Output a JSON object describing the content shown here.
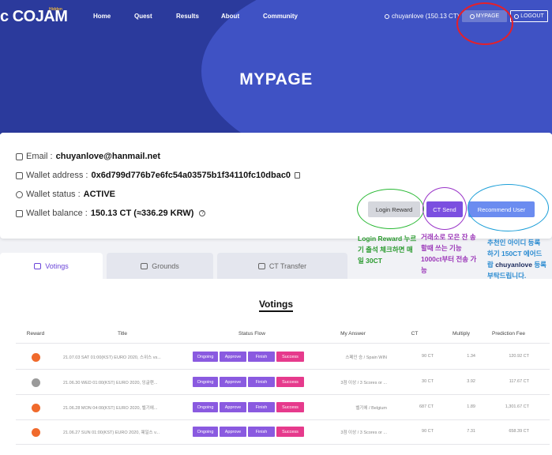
{
  "header": {
    "logo": "COJAM",
    "logo_sub": "Hidden",
    "nav": [
      "Home",
      "Quest",
      "Results",
      "About",
      "Community"
    ],
    "user": "chuyanlove (150.13 CT)",
    "mypage_label": "MYPAGE",
    "logout_label": "LOGOUT"
  },
  "hero": {
    "title": "MYPAGE"
  },
  "account": {
    "email_label": "Email : ",
    "email": "chuyanlove@hanmail.net",
    "wallet_address_label": "Wallet address : ",
    "wallet_address": "0x6d799d776b7e6fc54a03575b1f34110fc10dbac0",
    "wallet_status_label": "Wallet status : ",
    "wallet_status": "ACTIVE",
    "wallet_balance_label": "Wallet balance : ",
    "wallet_balance": "150.13 CT (≈336.29 KRW)"
  },
  "actions": {
    "login_reward": "Login Reward",
    "ct_send": "CT Send",
    "recommend_user": "Recommend User"
  },
  "annotations": {
    "green": "Login Reward 누르기 출석 체크하면 매일 30CT",
    "purple": "거래소로 모은 잔 송할때 쓰는 기능 1000ct부터 전송 가능",
    "blue_1": "추천인 아이디 등록 하기 150CT 에어드랍",
    "blue_name": "chuyanlove",
    "blue_2": " 등록 부탁드립니다."
  },
  "tabs": [
    "Votings",
    "Grounds",
    "CT Transfer"
  ],
  "votings": {
    "title": "Votings",
    "columns": [
      "Reward",
      "Title",
      "Status Flow",
      "My Answer",
      "CT",
      "Multiply",
      "Prediction Fee"
    ],
    "status_labels": [
      "Ongoing",
      "Approve",
      "Finish",
      "Success"
    ],
    "rows": [
      {
        "reward_color": "#f06a2c",
        "title": "21.07.03 SAT 01:00(KST) EURO 2020, 스위스 vs...",
        "answer": "스페인 승 / Spain WIN",
        "ct": "90 CT",
        "multiply": "1.34",
        "fee": "120.92 CT"
      },
      {
        "reward_color": "#9a9a9a",
        "title": "21.06.30 WED 01:00(KST) EURO 2020, 잉글랜...",
        "answer": "3점 이상 / 3 Scores or ...",
        "ct": "30 CT",
        "multiply": "3.92",
        "fee": "117.67 CT"
      },
      {
        "reward_color": "#f06a2c",
        "title": "21.06.28 MON 04:00(KST) EURO 2020, 벨기에...",
        "answer": "벨기에 / Belgium",
        "ct": "687 CT",
        "multiply": "1.89",
        "fee": "1,301.67 CT"
      },
      {
        "reward_color": "#f06a2c",
        "title": "21.06.27 SUN 01:00(KST) EURO 2020, 웨일스 v...",
        "answer": "3점 이상 / 3 Scores or ...",
        "ct": "90 CT",
        "multiply": "7.31",
        "fee": "658.39 CT"
      }
    ]
  }
}
